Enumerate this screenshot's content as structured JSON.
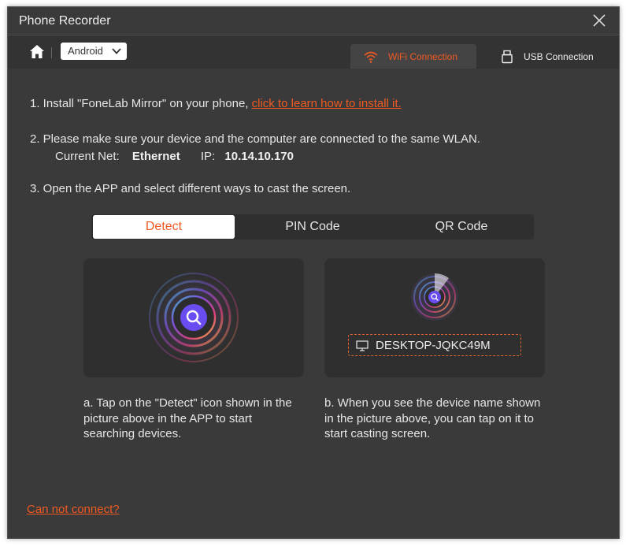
{
  "window": {
    "title": "Phone Recorder"
  },
  "toolbar": {
    "device_select": {
      "value": "Android"
    },
    "tabs": [
      {
        "label": "WiFi Connection",
        "icon": "wifi-icon",
        "active": true
      },
      {
        "label": "USB Connection",
        "icon": "usb-icon",
        "active": false
      }
    ]
  },
  "steps": {
    "step1_text": "1. Install \"FoneLab Mirror\" on your phone, ",
    "step1_link": "click to learn how to install it.",
    "step2_text": "2. Please make sure your device and the computer are connected to the same WLAN.",
    "current_net_label": "Current Net:",
    "current_net_value": "Ethernet",
    "ip_label": "IP:",
    "ip_value": "10.14.10.170",
    "step3_text": "3. Open the APP and select different ways to cast the screen."
  },
  "cast_tabs": [
    {
      "label": "Detect",
      "active": true
    },
    {
      "label": "PIN Code",
      "active": false
    },
    {
      "label": "QR Code",
      "active": false
    }
  ],
  "detect_card": {
    "icon": "detect-icon"
  },
  "device_card": {
    "device_name": "DESKTOP-JQKC49M",
    "icon": "monitor-icon"
  },
  "descriptions": {
    "a": "a. Tap on the \"Detect\" icon shown in the picture above in the APP to start searching devices.",
    "b": "b. When you see the device name shown in the picture above, you can tap on it to start casting screen."
  },
  "footer": {
    "help_link": "Can not connect?"
  },
  "colors": {
    "accent": "#f05a22",
    "background": "#3a3a3a",
    "card": "#2f2f2f"
  }
}
